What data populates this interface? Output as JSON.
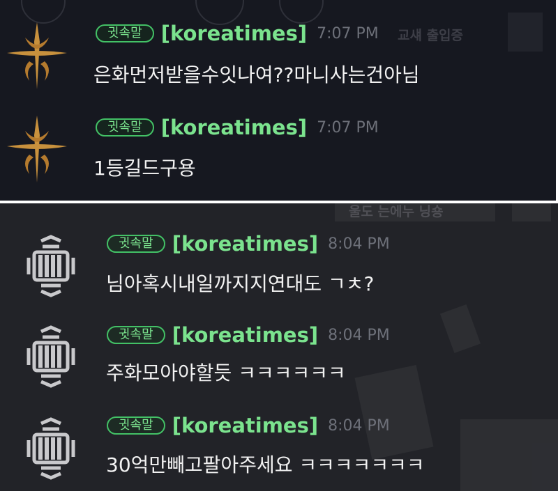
{
  "backdrop": {
    "top_text": "교섀 출입증",
    "bottom_text": "울도 는에누 닝숑"
  },
  "messages": [
    {
      "badge": "귓속말",
      "sender": "[koreatimes]",
      "time": "7:07 PM",
      "text": "은화먼저받을수잇나여??마니사는건아님",
      "avatar": "sword-emblem-icon"
    },
    {
      "badge": "귓속말",
      "sender": "[koreatimes]",
      "time": "7:07 PM",
      "text": "1등길드구용",
      "avatar": "sword-emblem-icon"
    },
    {
      "badge": "귓속말",
      "sender": "[koreatimes]",
      "time": "8:04 PM",
      "text": "님아혹시내일까지지연대도 ㄱㅊ?",
      "avatar": "fist-emblem-icon"
    },
    {
      "badge": "귓속말",
      "sender": "[koreatimes]",
      "time": "8:04 PM",
      "text": "주화모아야할듯 ㅋㅋㅋㅋㅋㅋ",
      "avatar": "fist-emblem-icon"
    },
    {
      "badge": "귓속말",
      "sender": "[koreatimes]",
      "time": "8:04 PM",
      "text": "30억만빼고팔아주세요 ㅋㅋㅋㅋㅋㅋㅋ",
      "avatar": "fist-emblem-icon"
    }
  ],
  "colors": {
    "accent_green": "#7be38e",
    "badge_border": "#43c166",
    "timestamp": "#6d7079",
    "text": "#f2f2f2",
    "sword_gold": "#c8913d",
    "emblem_gray": "#c9c9cc"
  }
}
